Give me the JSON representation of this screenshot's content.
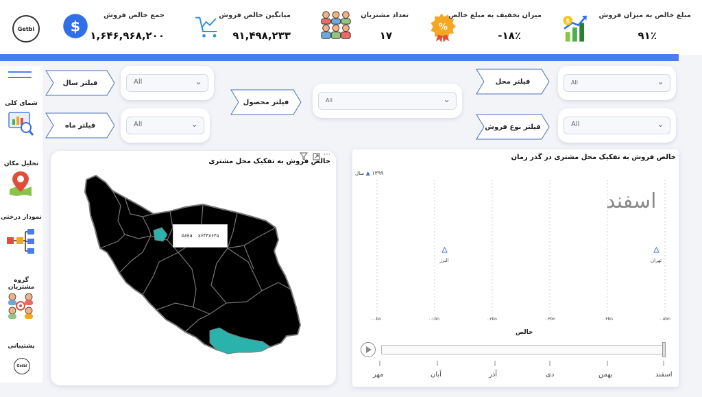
{
  "header": {
    "logo_text": "Getbi",
    "kpis": [
      {
        "title": "جمع خالص فروش",
        "value": "۱,۶۴۶,۹۶۸,۲۰۰",
        "icon": "dollar-icon"
      },
      {
        "title": "میانگین خالص فروش",
        "value": "۹۱,۴۹۸,۲۳۳",
        "icon": "cart-chart-icon"
      },
      {
        "title": "تعداد مشتریان",
        "value": "۱۷",
        "icon": "people-group-icon"
      },
      {
        "title": "میزان تخفیف به مبلغ خالص",
        "value": "-۱۸٪",
        "icon": "discount-badge-icon"
      },
      {
        "title": "مبلغ خالص به میزان فروش",
        "value": "۹۱٪",
        "icon": "growth-bars-icon"
      }
    ],
    "accent_color": "#4a7cf0"
  },
  "nav": {
    "items": [
      {
        "label": "شمای کلی",
        "icon": "dashboard-magnifier-icon"
      },
      {
        "label": "تحلیل مکان",
        "icon": "map-pin-icon"
      },
      {
        "label": "نمودار درختی",
        "icon": "tree-diagram-icon"
      },
      {
        "label": "گروه مشتریان",
        "icon": "customer-group-icon"
      },
      {
        "label": "پشتیبانی",
        "icon": "support-logo-icon"
      }
    ],
    "support_logo_text": "Getbi"
  },
  "filters": {
    "year_label": "فیلتر سال",
    "month_label": "فیلتر ماه",
    "product_label": "فیلتر محصول",
    "location_label": "فیلتر محل",
    "sales_type_label": "فیلتر نوع فروش",
    "year_value": "All",
    "month_value": "All",
    "product_value": "All",
    "location_value": "All",
    "sales_type_value": "All"
  },
  "map_card": {
    "title": "خالص فروش به تفکیک محل مشتری",
    "tooltip_key": "Area",
    "tooltip_value": "x۶۴۴x۶۴۵",
    "fill_color": "#000000",
    "highlight_color": "#2ab3ad"
  },
  "time_card": {
    "title": "خالص فروش به تفکیک محل مشتری در گذر زمان",
    "legend_year": "۱۳۹۹",
    "legend_label": "سال",
    "current_month": "اسفند",
    "x_axis_title": "خالص",
    "x_ticks": [
      "۰.۰bn",
      "۰.۱bn",
      "۰.۲bn",
      "۰.۳bn",
      "۰.۴bn",
      "۰.۵bn"
    ],
    "points": [
      {
        "label": "البرز"
      },
      {
        "label": "تهران"
      }
    ],
    "months": [
      "اسفند",
      "بهمن",
      "دی",
      "آذر",
      "آبان",
      "مهر"
    ]
  }
}
